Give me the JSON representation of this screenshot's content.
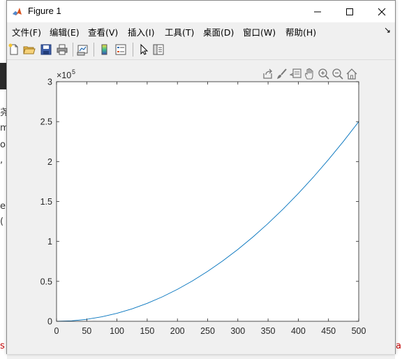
{
  "window": {
    "title": "Figure 1",
    "controls": {
      "minimize": "—",
      "maximize": "☐",
      "close": "✕"
    }
  },
  "menu": {
    "items": [
      "文件(F)",
      "编辑(E)",
      "查看(V)",
      "插入(I)",
      "工具(T)",
      "桌面(D)",
      "窗口(W)",
      "帮助(H)"
    ],
    "overflow_arrow": "↘"
  },
  "toolbar": {
    "icons": [
      "new-figure-icon",
      "open-file-icon",
      "save-icon",
      "print-icon",
      "link-plot-icon",
      "colorbar-icon",
      "legend-icon",
      "select-pointer-icon",
      "property-inspector-icon"
    ]
  },
  "axes_toolbar": {
    "icons": [
      "export-icon",
      "brush-icon",
      "datatip-icon",
      "pan-icon",
      "zoom-in-icon",
      "zoom-out-icon",
      "home-icon"
    ]
  },
  "background_fragments": {
    "left": [
      "尧",
      "m",
      "o",
      ",",
      "e",
      "("
    ],
    "bottom_left": "s",
    "right": [
      "a"
    ]
  },
  "chart_data": {
    "type": "line",
    "title": "",
    "xlabel": "",
    "ylabel": "",
    "xlim": [
      0,
      500
    ],
    "ylim": [
      0,
      300000
    ],
    "x_ticks": [
      0,
      50,
      100,
      150,
      200,
      250,
      300,
      350,
      400,
      450,
      500
    ],
    "x_tick_labels": [
      "0",
      "50",
      "100",
      "150",
      "200",
      "250",
      "300",
      "350",
      "400",
      "450",
      "500"
    ],
    "y_ticks": [
      0,
      50000,
      100000,
      150000,
      200000,
      250000,
      300000
    ],
    "y_tick_labels": [
      "0",
      "0.5",
      "1",
      "1.5",
      "2",
      "2.5",
      "3"
    ],
    "y_exponent_label": "×10",
    "y_exponent_power": "5",
    "grid": false,
    "line_color": "#0072bd",
    "series": [
      {
        "x": [
          0,
          25,
          50,
          75,
          100,
          125,
          150,
          175,
          200,
          225,
          250,
          275,
          300,
          325,
          350,
          375,
          400,
          425,
          450,
          475,
          500
        ],
        "values": [
          0,
          625,
          2500,
          5625,
          10000,
          15625,
          22500,
          30625,
          40000,
          50625,
          62500,
          75625,
          90000,
          105625,
          122500,
          140625,
          160000,
          180625,
          202500,
          225625,
          250000
        ]
      }
    ]
  }
}
